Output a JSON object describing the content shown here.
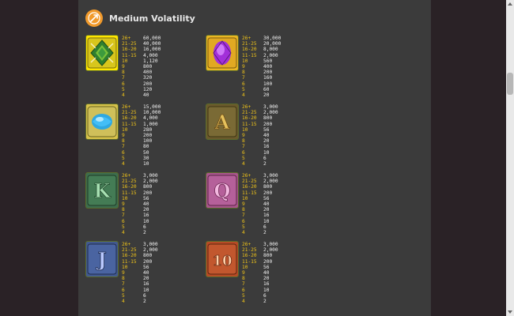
{
  "header": {
    "title": "Medium Volatility",
    "icon": "volatility-arrow-icon",
    "accent": "#f19a2b"
  },
  "labels": {
    "count_color": "#f0c419",
    "value_color": "#f0f0f0"
  },
  "symbols": [
    {
      "name": "green-emblem",
      "icon": "green-emblem-icon",
      "color": "#8aa61a",
      "counts": [
        "26+",
        "21-25",
        "16-20",
        "11-15",
        "10",
        "9",
        "8",
        "7",
        "6",
        "5",
        "4"
      ],
      "values": [
        "60,000",
        "40,000",
        "16,000",
        "4,000",
        "1,120",
        "800",
        "400",
        "320",
        "200",
        "120",
        "40"
      ]
    },
    {
      "name": "purple-gem",
      "icon": "purple-gem-icon",
      "color": "#b23be0",
      "counts": [
        "26+",
        "21-25",
        "16-20",
        "11-15",
        "10",
        "9",
        "8",
        "7",
        "6",
        "5",
        "4"
      ],
      "values": [
        "30,000",
        "20,000",
        "8,000",
        "2,000",
        "560",
        "400",
        "200",
        "160",
        "100",
        "60",
        "20"
      ]
    },
    {
      "name": "blue-gem",
      "icon": "blue-gem-icon",
      "color": "#2fa8e0",
      "counts": [
        "26+",
        "21-25",
        "16-20",
        "11-15",
        "10",
        "9",
        "8",
        "7",
        "6",
        "5",
        "4"
      ],
      "values": [
        "15,000",
        "10,000",
        "4,000",
        "1,000",
        "280",
        "200",
        "100",
        "80",
        "50",
        "30",
        "10"
      ]
    },
    {
      "name": "a-card",
      "icon": "letter-a-icon",
      "color": "#c89a3a",
      "glyph": "A",
      "counts": [
        "26+",
        "21-25",
        "16-20",
        "11-15",
        "10",
        "9",
        "8",
        "7",
        "6",
        "5",
        "4"
      ],
      "values": [
        "3,000",
        "2,000",
        "800",
        "200",
        "56",
        "40",
        "20",
        "16",
        "10",
        "6",
        "2"
      ]
    },
    {
      "name": "k-card",
      "icon": "letter-k-icon",
      "color": "#4c8a5e",
      "glyph": "K",
      "counts": [
        "26+",
        "21-25",
        "16-20",
        "11-15",
        "10",
        "9",
        "8",
        "7",
        "6",
        "5",
        "4"
      ],
      "values": [
        "3,000",
        "2,000",
        "800",
        "200",
        "56",
        "40",
        "20",
        "16",
        "10",
        "6",
        "2"
      ]
    },
    {
      "name": "q-card",
      "icon": "letter-q-icon",
      "color": "#c46aa6",
      "glyph": "Q",
      "counts": [
        "26+",
        "21-25",
        "16-20",
        "11-15",
        "10",
        "9",
        "8",
        "7",
        "6",
        "5",
        "4"
      ],
      "values": [
        "3,000",
        "2,000",
        "800",
        "200",
        "56",
        "40",
        "20",
        "16",
        "10",
        "6",
        "2"
      ]
    },
    {
      "name": "j-card",
      "icon": "letter-j-icon",
      "color": "#4c65a8",
      "glyph": "J",
      "counts": [
        "26+",
        "21-25",
        "16-20",
        "11-15",
        "10",
        "9",
        "8",
        "7",
        "6",
        "5",
        "4"
      ],
      "values": [
        "3,000",
        "2,000",
        "800",
        "200",
        "56",
        "40",
        "20",
        "16",
        "10",
        "6",
        "2"
      ]
    },
    {
      "name": "10-card",
      "icon": "number-10-icon",
      "color": "#c0552c",
      "glyph": "10",
      "counts": [
        "26+",
        "21-25",
        "16-20",
        "11-15",
        "10",
        "9",
        "8",
        "7",
        "6",
        "5",
        "4"
      ],
      "values": [
        "3,000",
        "2,000",
        "800",
        "200",
        "56",
        "40",
        "20",
        "16",
        "10",
        "6",
        "2"
      ]
    }
  ]
}
